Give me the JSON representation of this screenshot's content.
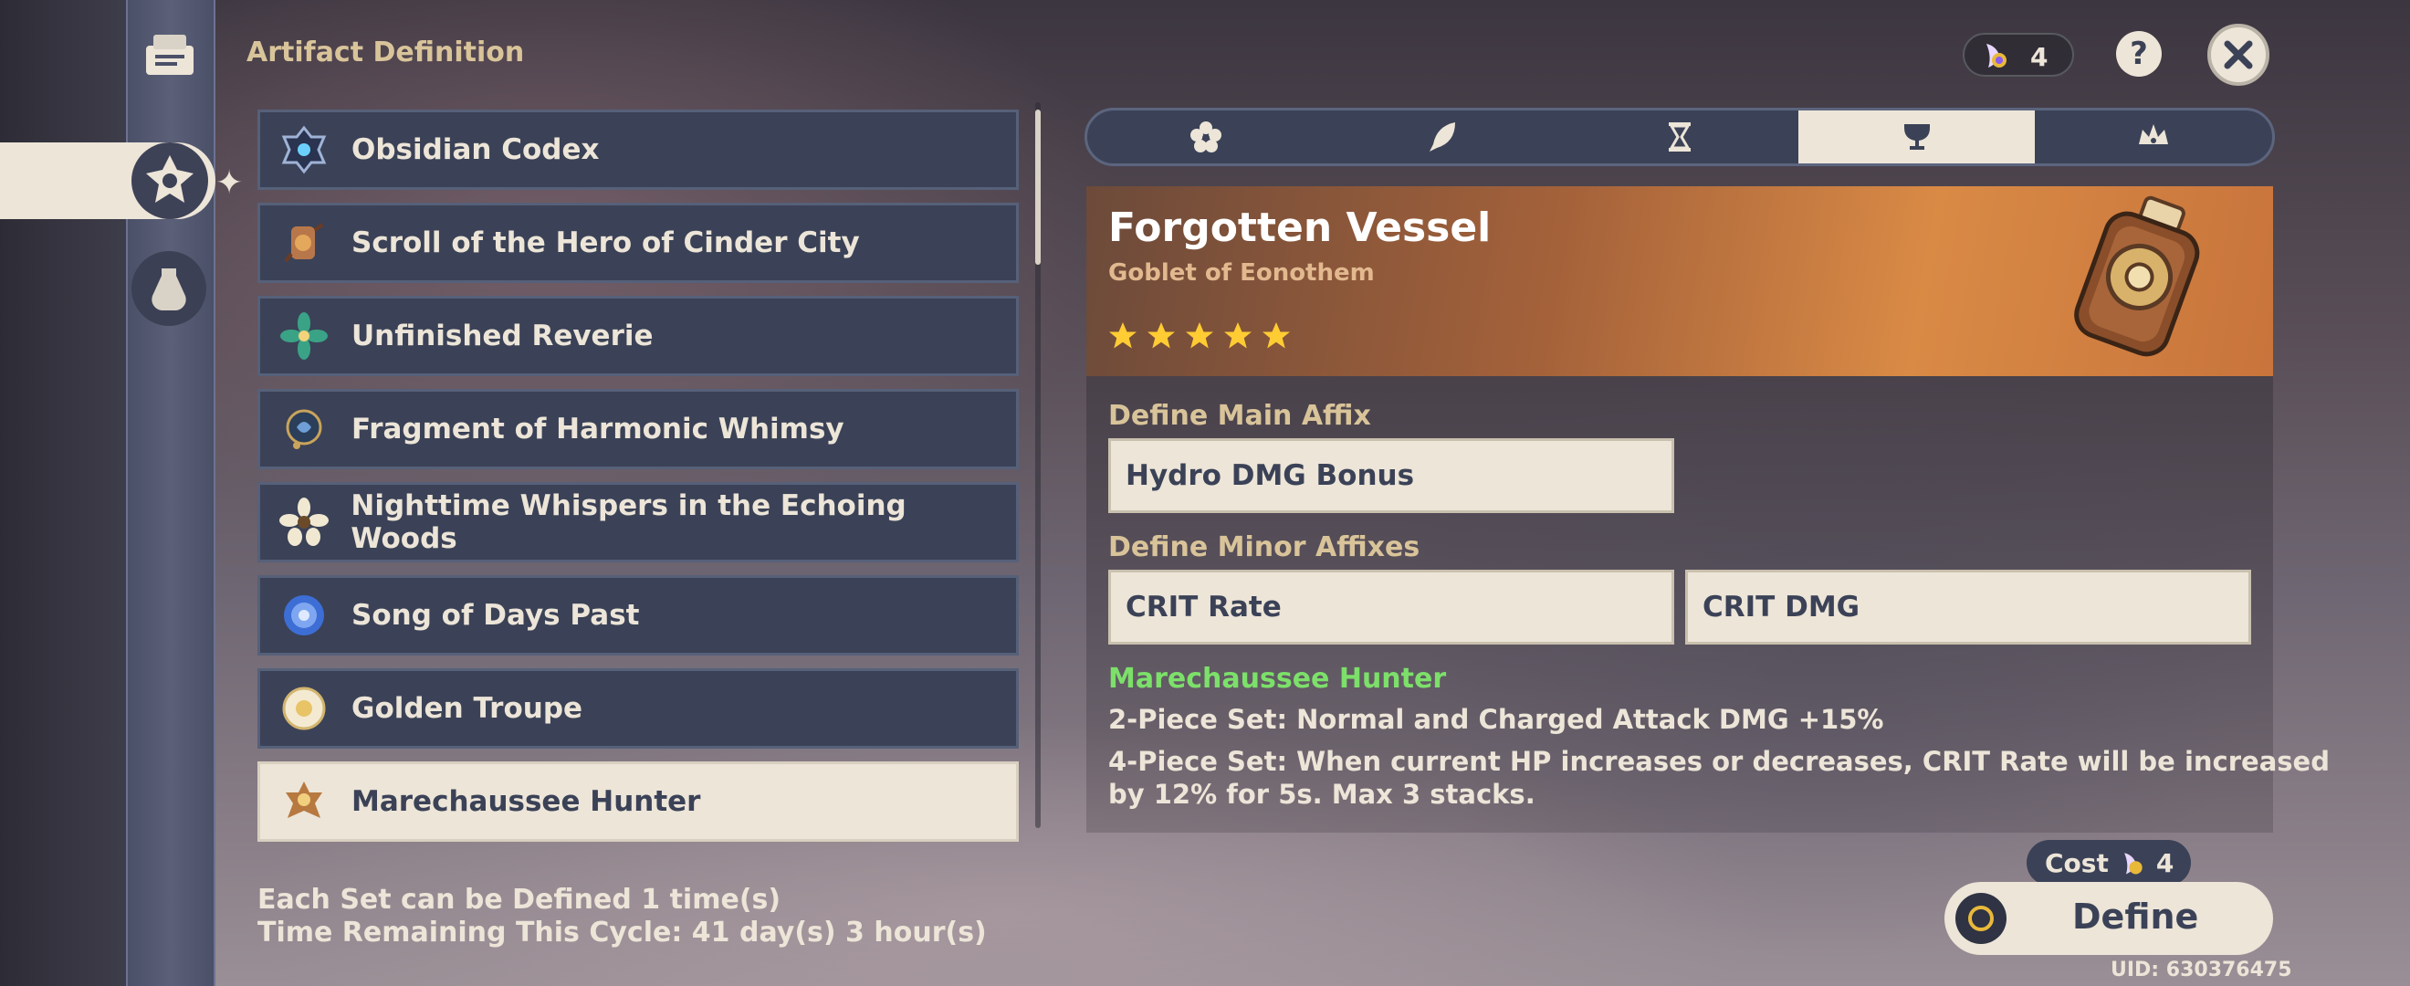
{
  "header": {
    "title": "Artifact Definition"
  },
  "top_right": {
    "resin_count": "4",
    "help_label": "?"
  },
  "sets": [
    {
      "name": "Obsidian Codex",
      "icon": "obsidian-codex-icon"
    },
    {
      "name": "Scroll of the Hero of Cinder City",
      "icon": "scroll-icon"
    },
    {
      "name": "Unfinished Reverie",
      "icon": "reverie-flower-icon"
    },
    {
      "name": "Fragment of Harmonic Whimsy",
      "icon": "harmonic-whimsy-icon"
    },
    {
      "name": "Nighttime Whispers in the Echoing Woods",
      "icon": "nighttime-flower-icon"
    },
    {
      "name": "Song of Days Past",
      "icon": "song-flower-icon"
    },
    {
      "name": "Golden Troupe",
      "icon": "golden-troupe-icon"
    },
    {
      "name": "Marechaussee Hunter",
      "icon": "marechaussee-icon",
      "selected": true
    }
  ],
  "footer": {
    "line1": "Each Set can be Defined 1 time(s)",
    "line2": "Time Remaining This Cycle: 41 day(s) 3 hour(s)"
  },
  "slot_tabs": [
    {
      "icon": "flower-icon"
    },
    {
      "icon": "plume-icon"
    },
    {
      "icon": "hourglass-icon"
    },
    {
      "icon": "goblet-icon",
      "active": true
    },
    {
      "icon": "circlet-icon"
    }
  ],
  "artifact": {
    "name": "Forgotten Vessel",
    "type": "Goblet of Eonothem",
    "stars": 5
  },
  "main_affix": {
    "label": "Define Main Affix",
    "value": "Hydro DMG Bonus"
  },
  "minor_affixes": {
    "label": "Define Minor Affixes",
    "values": [
      "CRIT Rate",
      "CRIT DMG"
    ]
  },
  "set_effect": {
    "name": "Marechaussee Hunter",
    "two_piece": "2-Piece Set: Normal and Charged Attack DMG +15%",
    "four_piece_line1": "4-Piece Set: When current HP increases or decreases, CRIT Rate will be increased",
    "four_piece_line2": "by 12% for 5s. Max 3 stacks."
  },
  "cost": {
    "label": "Cost",
    "value": "4"
  },
  "define_button": {
    "label": "Define"
  },
  "uid": "UID: 630376475",
  "colors": {
    "accent_cream": "#ece5d8",
    "panel_navy": "#3b4257",
    "gold_label": "#d9c49a",
    "set_green": "#7ce06a"
  }
}
